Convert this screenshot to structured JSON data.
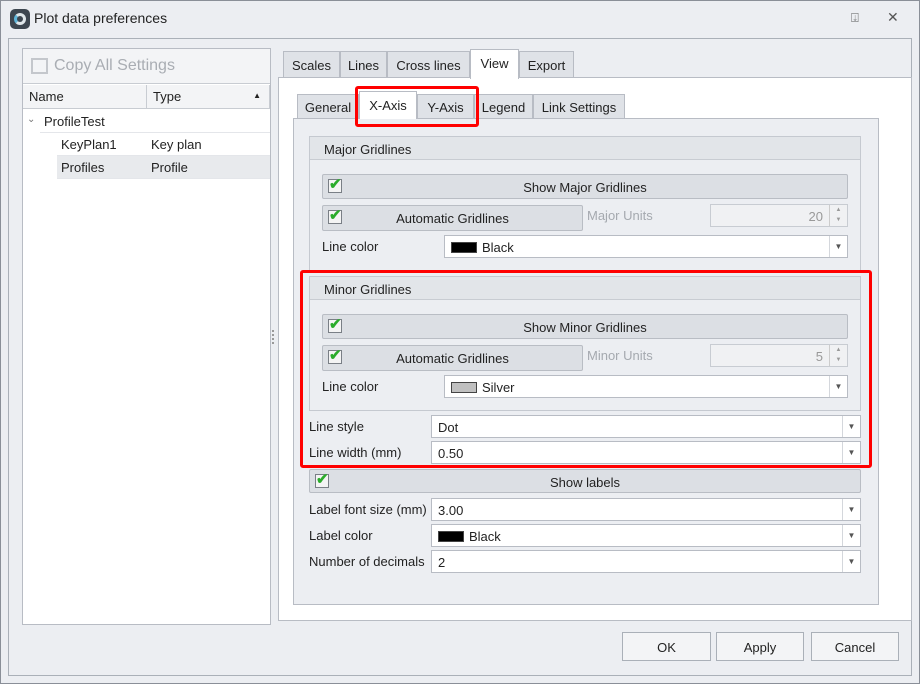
{
  "window": {
    "title": "Plot data preferences"
  },
  "left": {
    "copy_all": "Copy All Settings",
    "columns": [
      "Name",
      "Type"
    ],
    "rows": [
      {
        "name": "ProfileTest",
        "type": ""
      },
      {
        "name": "KeyPlan1",
        "type": "Key plan"
      },
      {
        "name": "Profiles",
        "type": "Profile"
      }
    ]
  },
  "tabs": [
    "Scales",
    "Lines",
    "Cross lines",
    "View",
    "Export"
  ],
  "subtabs": [
    "General",
    "X-Axis",
    "Y-Axis",
    "Legend",
    "Link Settings"
  ],
  "major": {
    "title": "Major Gridlines",
    "show": "Show Major Gridlines",
    "auto": "Automatic Gridlines",
    "units_label": "Major Units",
    "units": "20",
    "color_label": "Line color",
    "color": "Black",
    "color_hex": "#000000"
  },
  "minor": {
    "title": "Minor Gridlines",
    "show": "Show Minor Gridlines",
    "auto": "Automatic Gridlines",
    "units_label": "Minor Units",
    "units": "5",
    "color_label": "Line color",
    "color": "Silver",
    "color_hex": "#c0c0c0"
  },
  "line_style": {
    "label": "Line style",
    "value": "Dot"
  },
  "line_width": {
    "label": "Line width (mm)",
    "value": "0.50"
  },
  "show_labels": "Show labels",
  "label_font": {
    "label": "Label font size (mm)",
    "value": "3.00"
  },
  "label_color": {
    "label": "Label color",
    "value": "Black",
    "hex": "#000000"
  },
  "decimals": {
    "label": "Number of decimals",
    "value": "2"
  },
  "buttons": {
    "ok": "OK",
    "apply": "Apply",
    "cancel": "Cancel"
  }
}
